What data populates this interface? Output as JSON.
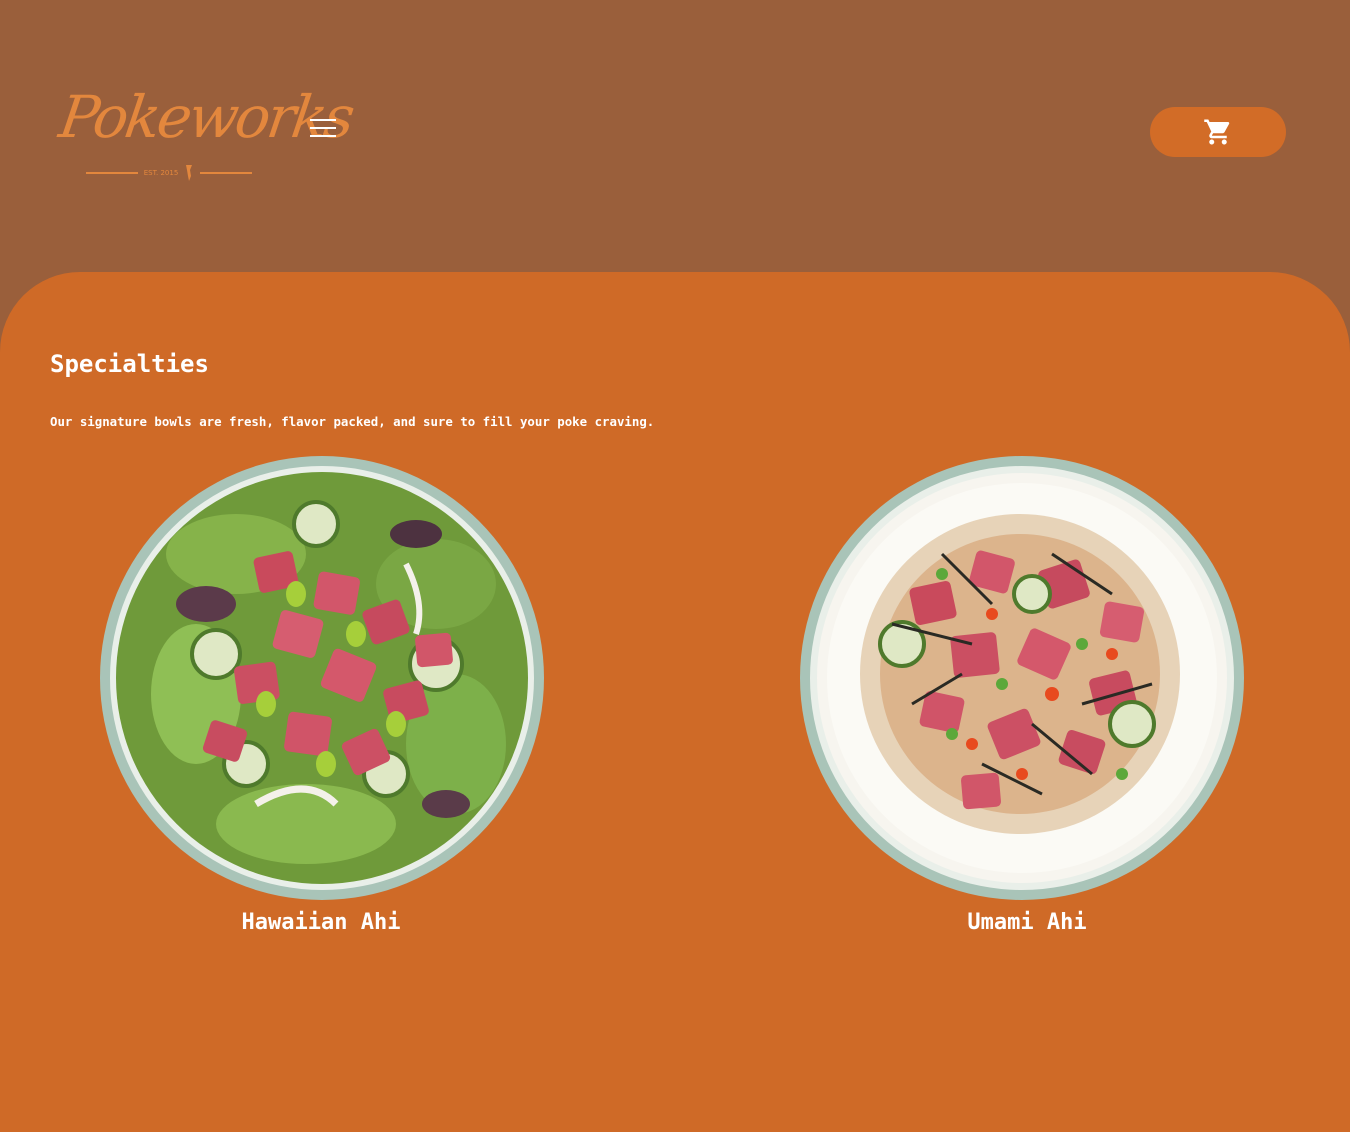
{
  "brand": {
    "name": "Pokeworks",
    "tagline": "EST. 2015",
    "color": "#e3873d"
  },
  "header": {
    "menu_icon": "hamburger-menu-icon",
    "cart_icon": "shopping-cart-icon",
    "background": "#9a5f3b",
    "cart_button_color": "#d26c27"
  },
  "specialties": {
    "title": "Specialties",
    "subtitle": "Our signature bowls are fresh, flavor packed, and sure to fill your poke craving.",
    "background": "#cf6a27",
    "items": [
      {
        "name": "Hawaiian Ahi",
        "image": "hawaiian-ahi-bowl"
      },
      {
        "name": "Umami Ahi",
        "image": "umami-ahi-bowl"
      }
    ]
  }
}
